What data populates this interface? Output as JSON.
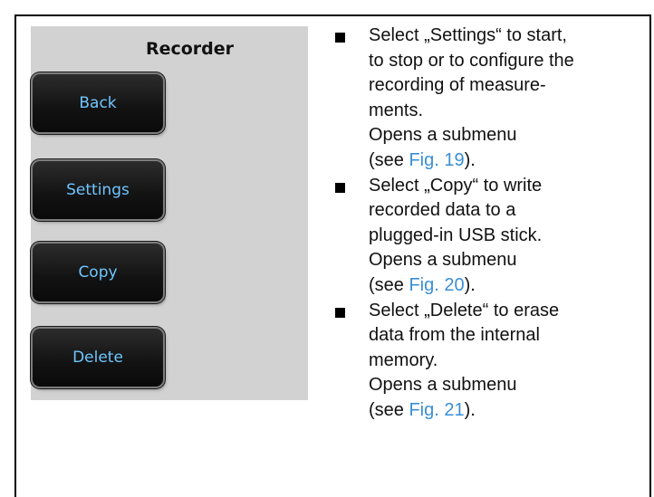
{
  "recorder": {
    "title": "Recorder",
    "buttons": [
      "Back",
      "Settings",
      "Copy",
      "Delete"
    ]
  },
  "bullets": [
    {
      "lines": [
        "Select „Settings“ to start,",
        "to stop or to configure the",
        "recording of measure-",
        "ments.",
        "Opens a submenu"
      ],
      "ref_prefix": "(see ",
      "ref_link": "Fig. 19",
      "ref_suffix": ")."
    },
    {
      "lines": [
        "Select „Copy“ to write",
        "recorded data to a",
        "plugged-in USB stick.",
        "Opens a submenu"
      ],
      "ref_prefix": "(see ",
      "ref_link": "Fig. 20",
      "ref_suffix": ")."
    },
    {
      "lines": [
        "Select „Delete“ to erase",
        "data from the internal",
        "memory.",
        "Opens a submenu"
      ],
      "ref_prefix": "(see ",
      "ref_link": "Fig. 21",
      "ref_suffix": ")."
    }
  ],
  "colors": {
    "link": "#3a8fd6",
    "button_text": "#6ec6ff",
    "screen_bg": "#d2d2d2"
  }
}
